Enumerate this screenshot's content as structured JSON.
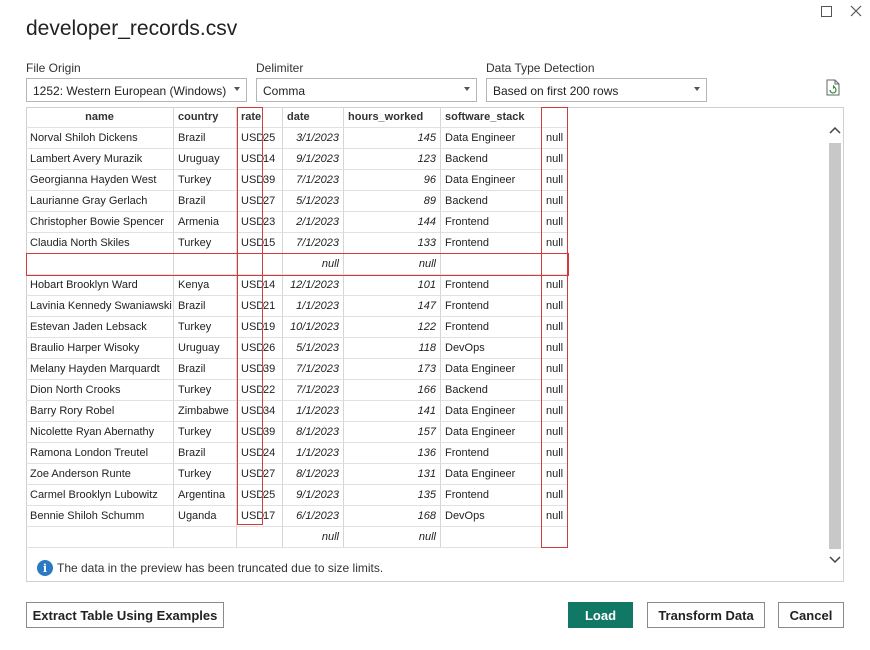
{
  "window": {
    "title": "developer_records.csv"
  },
  "options": {
    "file_origin": {
      "label": "File Origin",
      "value": "1252: Western European (Windows)"
    },
    "delimiter": {
      "label": "Delimiter",
      "value": "Comma"
    },
    "detection": {
      "label": "Data Type Detection",
      "value": "Based on first 200 rows"
    }
  },
  "table": {
    "headers": [
      "name",
      "country",
      "rate",
      "date",
      "hours_worked",
      "software_stack",
      ""
    ],
    "rows": [
      {
        "name": "Norval Shiloh Dickens",
        "country": "Brazil",
        "cur": "USD",
        "rate": "25",
        "date": "3/1/2023",
        "hours": "145",
        "stack": "Data Engineer",
        "extra": "null"
      },
      {
        "name": "Lambert Avery Murazik",
        "country": "Uruguay",
        "cur": "USD",
        "rate": "14",
        "date": "9/1/2023",
        "hours": "123",
        "stack": "Backend",
        "extra": "null"
      },
      {
        "name": "Georgianna Hayden West",
        "country": "Turkey",
        "cur": "USD",
        "rate": "39",
        "date": "7/1/2023",
        "hours": "96",
        "stack": "Data Engineer",
        "extra": "null"
      },
      {
        "name": "Laurianne Gray Gerlach",
        "country": "Brazil",
        "cur": "USD",
        "rate": "27",
        "date": "5/1/2023",
        "hours": "89",
        "stack": "Backend",
        "extra": "null"
      },
      {
        "name": "Christopher Bowie Spencer",
        "country": "Armenia",
        "cur": "USD",
        "rate": "23",
        "date": "2/1/2023",
        "hours": "144",
        "stack": "Frontend",
        "extra": "null"
      },
      {
        "name": "Claudia North Skiles",
        "country": "Turkey",
        "cur": "USD",
        "rate": "15",
        "date": "7/1/2023",
        "hours": "133",
        "stack": "Frontend",
        "extra": "null"
      },
      {
        "name": "",
        "country": "",
        "cur": "",
        "rate": "",
        "date": "null",
        "hours": "null",
        "stack": "",
        "extra": ""
      },
      {
        "name": "Hobart Brooklyn Ward",
        "country": "Kenya",
        "cur": "USD",
        "rate": "14",
        "date": "12/1/2023",
        "hours": "101",
        "stack": "Frontend",
        "extra": "null"
      },
      {
        "name": "Lavinia Kennedy Swaniawski",
        "country": "Brazil",
        "cur": "USD",
        "rate": "21",
        "date": "1/1/2023",
        "hours": "147",
        "stack": "Frontend",
        "extra": "null"
      },
      {
        "name": "Estevan Jaden Lebsack",
        "country": "Turkey",
        "cur": "USD",
        "rate": "19",
        "date": "10/1/2023",
        "hours": "122",
        "stack": "Frontend",
        "extra": "null"
      },
      {
        "name": "Braulio Harper Wisoky",
        "country": "Uruguay",
        "cur": "USD",
        "rate": "26",
        "date": "5/1/2023",
        "hours": "118",
        "stack": "DevOps",
        "extra": "null"
      },
      {
        "name": "Melany Hayden Marquardt",
        "country": "Brazil",
        "cur": "USD",
        "rate": "39",
        "date": "7/1/2023",
        "hours": "173",
        "stack": "Data Engineer",
        "extra": "null"
      },
      {
        "name": "Dion North Crooks",
        "country": "Turkey",
        "cur": "USD",
        "rate": "22",
        "date": "7/1/2023",
        "hours": "166",
        "stack": "Backend",
        "extra": "null"
      },
      {
        "name": "Barry Rory Robel",
        "country": "Zimbabwe",
        "cur": "USD",
        "rate": "34",
        "date": "1/1/2023",
        "hours": "141",
        "stack": "Data Engineer",
        "extra": "null"
      },
      {
        "name": "Nicolette Ryan Abernathy",
        "country": "Turkey",
        "cur": "USD",
        "rate": "39",
        "date": "8/1/2023",
        "hours": "157",
        "stack": "Data Engineer",
        "extra": "null"
      },
      {
        "name": "Ramona London Treutel",
        "country": "Brazil",
        "cur": "USD",
        "rate": "24",
        "date": "1/1/2023",
        "hours": "136",
        "stack": "Frontend",
        "extra": "null"
      },
      {
        "name": "Zoe Anderson Runte",
        "country": "Turkey",
        "cur": "USD",
        "rate": "27",
        "date": "8/1/2023",
        "hours": "131",
        "stack": "Data Engineer",
        "extra": "null"
      },
      {
        "name": "Carmel Brooklyn Lubowitz",
        "country": "Argentina",
        "cur": "USD",
        "rate": "25",
        "date": "9/1/2023",
        "hours": "135",
        "stack": "Frontend",
        "extra": "null"
      },
      {
        "name": "Bennie Shiloh Schumm",
        "country": "Uganda",
        "cur": "USD",
        "rate": "17",
        "date": "6/1/2023",
        "hours": "168",
        "stack": "DevOps",
        "extra": "null"
      },
      {
        "name": "",
        "country": "",
        "cur": "",
        "rate": "",
        "date": "null",
        "hours": "null",
        "stack": "",
        "extra": ""
      }
    ]
  },
  "info": {
    "message": "The data in the preview has been truncated due to size limits.",
    "icon": "info-icon"
  },
  "buttons": {
    "extract": "Extract Table Using Examples",
    "load": "Load",
    "transform": "Transform Data",
    "cancel": "Cancel"
  },
  "colors": {
    "highlight": "#d23b3b",
    "primary": "#117865",
    "info": "#2b79c2"
  }
}
